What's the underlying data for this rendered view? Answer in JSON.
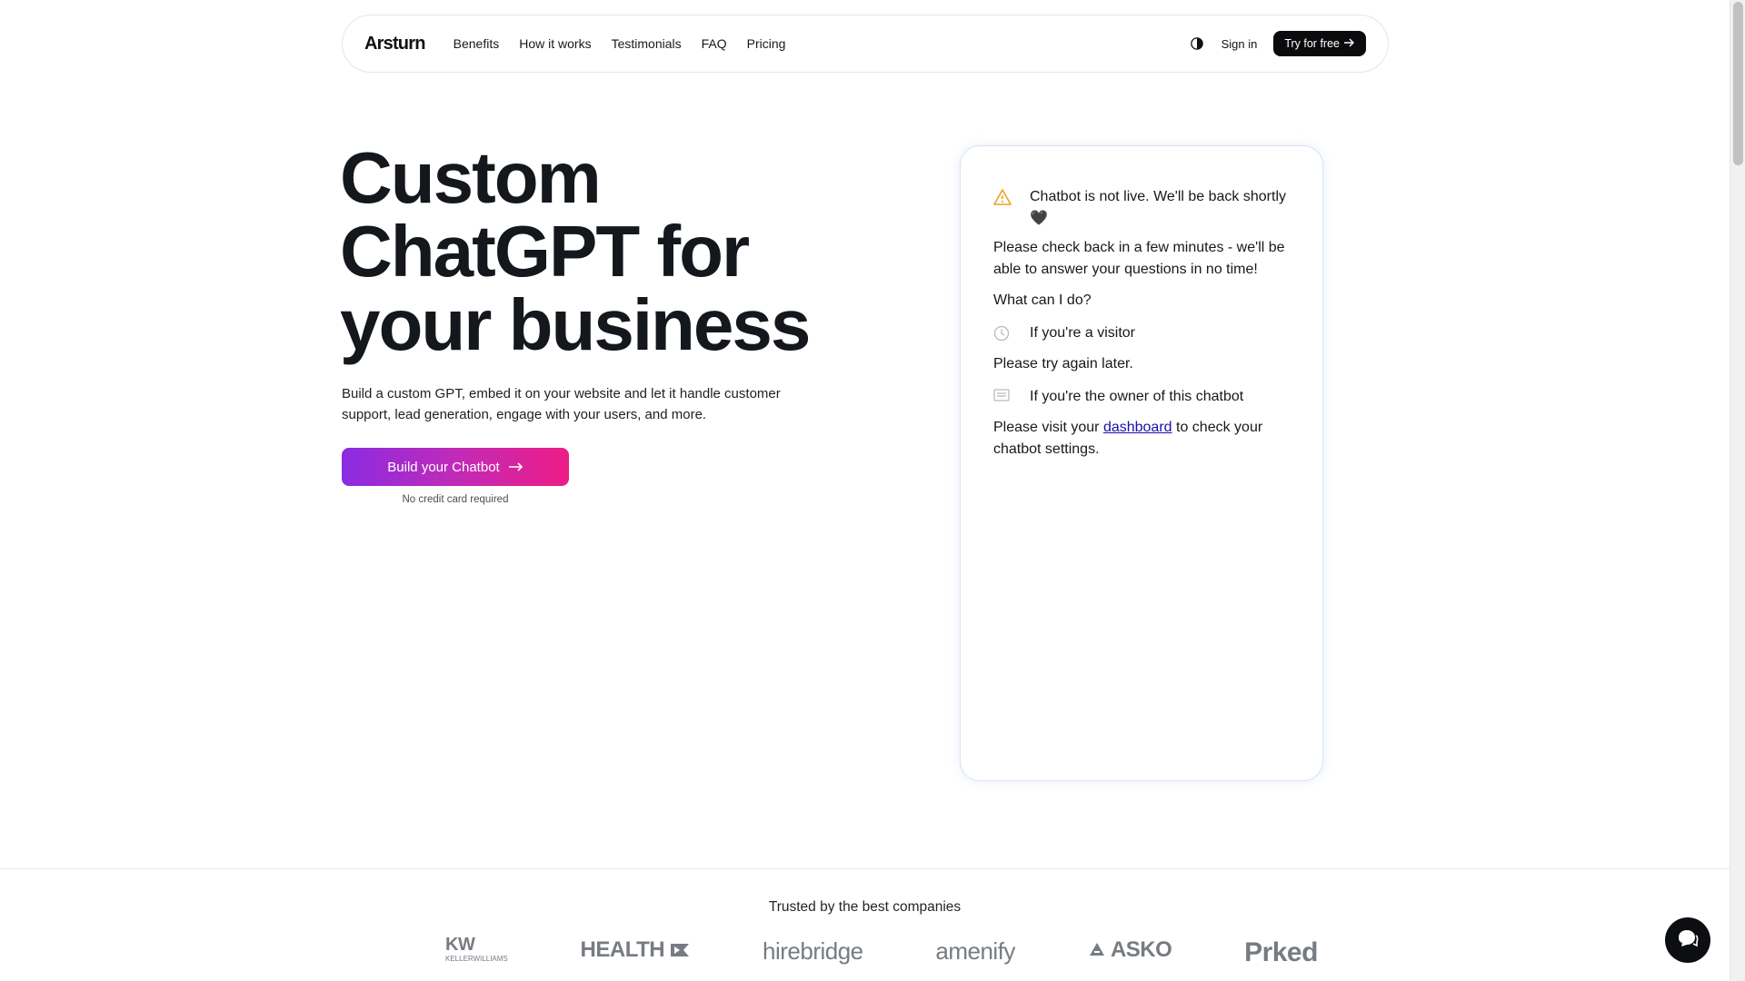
{
  "nav": {
    "logo": "Arsturn",
    "links": [
      "Benefits",
      "How it works",
      "Testimonials",
      "FAQ",
      "Pricing"
    ],
    "sign_in": "Sign in",
    "try_free": "Try for free",
    "theme_icon": "half-moon-icon"
  },
  "hero": {
    "title_lines": [
      "Custom",
      "ChatGPT for",
      "your business"
    ],
    "description": "Build a custom GPT, embed it on your website and let it handle customer support, lead generation, engage with your users, and more.",
    "cta": "Build your Chatbot",
    "cta_note": "No credit card required"
  },
  "chatbot": {
    "warning": "Chatbot is not live. We'll be back shortly 🖤",
    "check_back": "Please check back in a few minutes - we'll be able to answer your questions in no time!",
    "what_can_i_do": "What can I do?",
    "visitor_heading": "If you're a visitor",
    "visitor_text": "Please try again later.",
    "owner_heading": "If you're the owner of this chatbot",
    "owner_text_before": "Please visit your ",
    "owner_link": "dashboard",
    "owner_text_after": " to check your chatbot settings."
  },
  "trusted": {
    "label": "Trusted by the best companies",
    "companies": [
      "KW",
      "KELLERWILLIAMS",
      "HEALTH",
      "hirebridge",
      "amenify",
      "ASKO",
      "Prked"
    ]
  },
  "colors": {
    "cta_gradient_start": "#8a2be2",
    "cta_gradient_end": "#ee1c86",
    "warning": "#f0a020",
    "link": "#1a0dab"
  }
}
